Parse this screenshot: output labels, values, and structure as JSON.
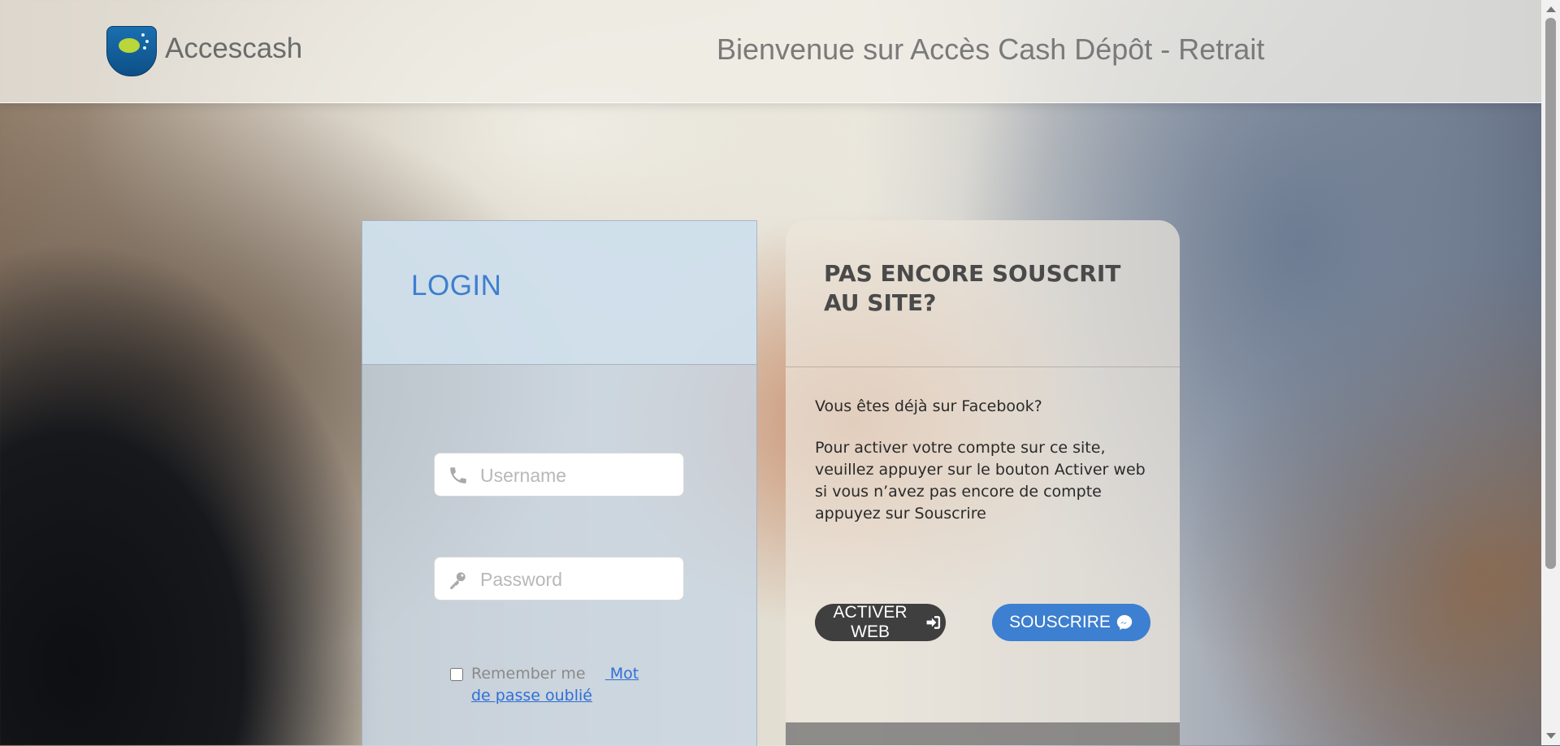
{
  "header": {
    "brand": "Accescash",
    "welcome": "Bienvenue sur Accès Cash Dépôt - Retrait",
    "logo_icon": "accescash-logo-icon"
  },
  "login": {
    "title": "LOGIN",
    "username": {
      "placeholder": "Username",
      "value": "",
      "icon": "phone-icon"
    },
    "password": {
      "placeholder": "Password",
      "value": "",
      "icon": "key-icon"
    },
    "remember_label": "Remember me",
    "forgot_link": " Mot de passe oublié"
  },
  "signup": {
    "title": "PAS ENCORE SOUSCRIT AU SITE?",
    "question": "Vous êtes déjà sur Facebook?",
    "instructions": "Pour activer votre compte sur ce site, veuillez appuyer sur le bouton Activer web si vous n’avez pas encore de compte appuyez sur Souscrire",
    "activer_label": "ACTIVER WEB",
    "activer_icon": "sign-in-icon",
    "souscrire_label": "SOUSCRIRE",
    "souscrire_icon": "messenger-icon"
  },
  "colors": {
    "accent_blue": "#3d7fd0",
    "dark_button": "#3f3f3f",
    "link_blue": "#2f6fd6"
  }
}
